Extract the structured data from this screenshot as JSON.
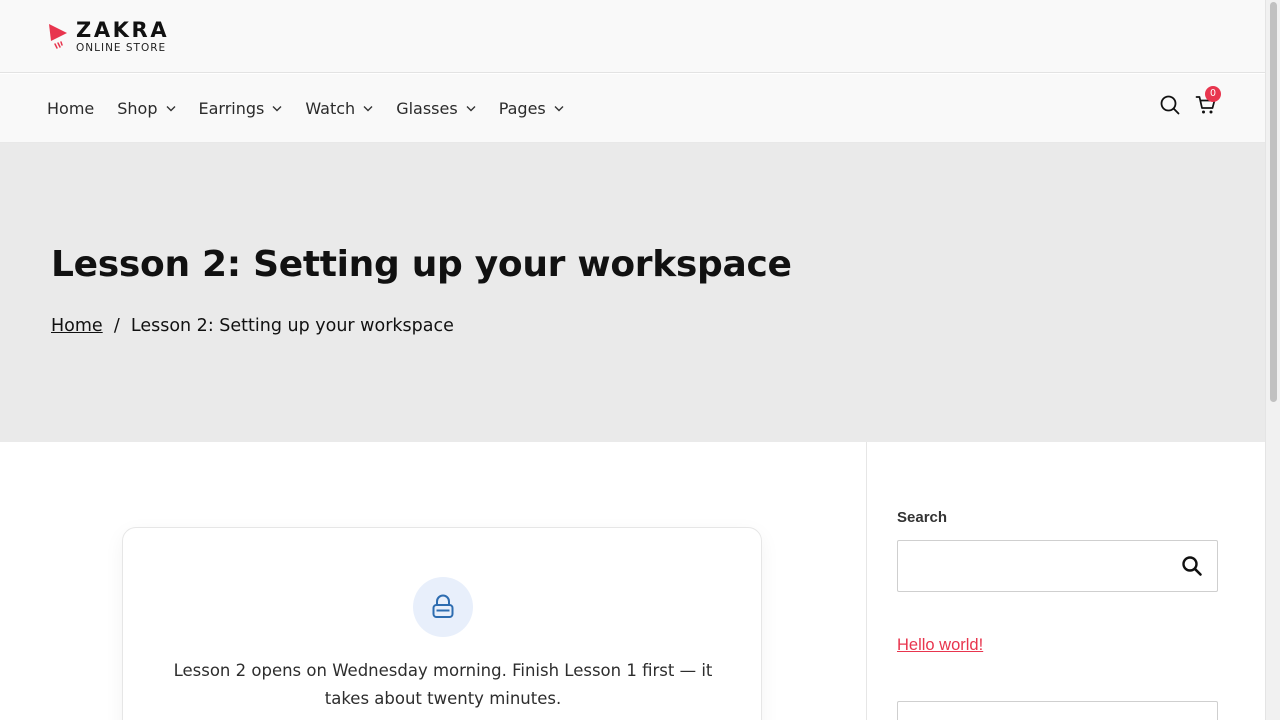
{
  "brand": {
    "name": "ZAKRA",
    "tagline": "ONLINE STORE",
    "accent_color": "#e8354e"
  },
  "nav": {
    "items": [
      {
        "label": "Home",
        "has_dropdown": false
      },
      {
        "label": "Shop",
        "has_dropdown": true
      },
      {
        "label": "Earrings",
        "has_dropdown": true
      },
      {
        "label": "Watch",
        "has_dropdown": true
      },
      {
        "label": "Glasses",
        "has_dropdown": true
      },
      {
        "label": "Pages",
        "has_dropdown": true
      }
    ],
    "cart_count": "0"
  },
  "hero": {
    "title": "Lesson 2: Setting up your workspace",
    "breadcrumb": {
      "home": "Home",
      "separator": "/",
      "current": "Lesson 2: Setting up your workspace"
    }
  },
  "lesson": {
    "locked_message": "Lesson 2 opens on Wednesday morning. Finish Lesson 1 first — it takes about twenty minutes.",
    "icon": "lock-icon"
  },
  "sidebar": {
    "search_label": "Search",
    "search_value": "",
    "post_link": "Hello world!"
  }
}
